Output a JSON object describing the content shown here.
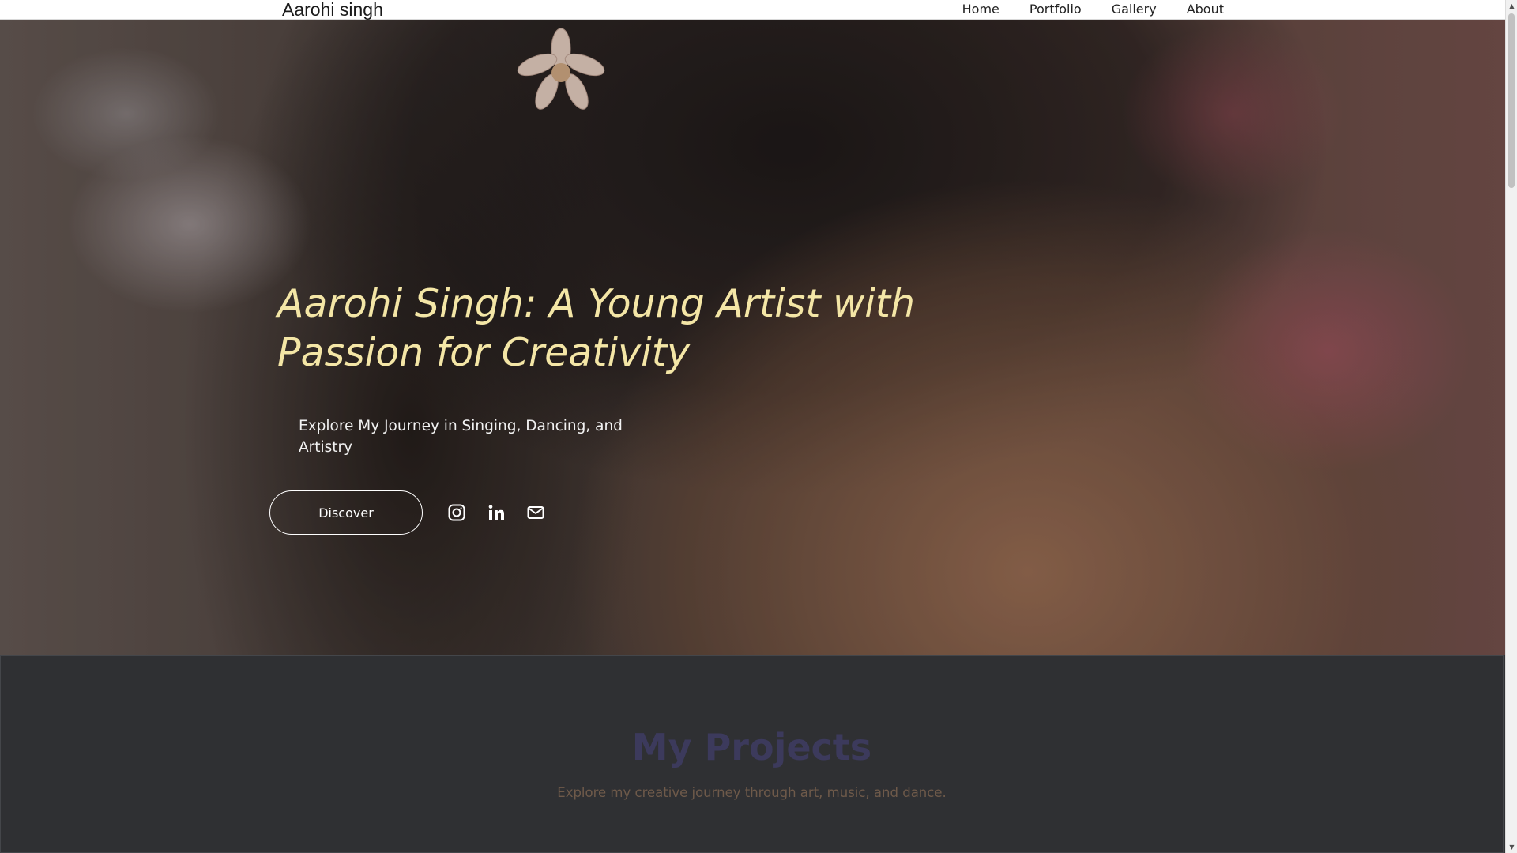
{
  "navbar": {
    "brand": "Aarohi singh",
    "links": [
      "Home",
      "Portfolio",
      "Gallery",
      "About"
    ]
  },
  "hero": {
    "title": "Aarohi Singh: A Young Artist with Passion for Creativity",
    "subtitle": "Explore My Journey in Singing, Dancing, and Artistry",
    "cta_label": "Discover",
    "social_icons": [
      "instagram-icon",
      "linkedin-icon",
      "mail-icon"
    ],
    "title_color": "#f4e6a6"
  },
  "projects": {
    "title": "My Projects",
    "subtitle": "Explore my creative journey through art, music, and dance."
  },
  "scrollbar": {
    "up_arrow": "▲",
    "down_arrow": "▼"
  }
}
